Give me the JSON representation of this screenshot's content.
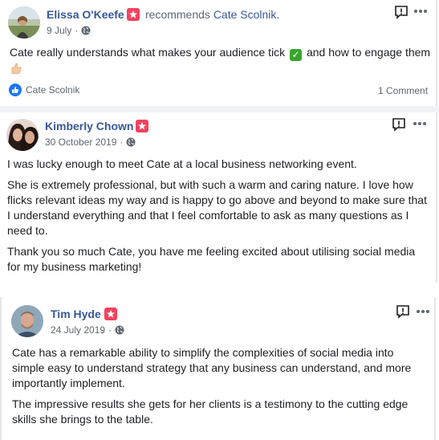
{
  "reviews": [
    {
      "author": "Elissa O'Keefe",
      "action": "recommends",
      "target": "Cate Scolnik.",
      "date": "9 July",
      "text_before_check": "Cate really understands what makes your audience tick ",
      "text_after_check": " and how to engage them",
      "reaction_name": "Cate Scolnik",
      "comments": "1 Comment"
    },
    {
      "author": "Kimberly Chown",
      "date": "30 October 2019",
      "paragraphs": [
        "I was lucky enough to meet Cate at a local business networking event.",
        "She is extremely professional, but with such a warm and caring nature. I love how flicks relevant ideas my way and is happy to go above and beyond to make sure that I understand everything and that I feel comfortable to ask as many questions as I need to.",
        "Thank you so much Cate, you have me feeling excited about utilising social media for my business marketing!"
      ]
    },
    {
      "author": "Tim Hyde",
      "date": "24 July 2019",
      "paragraphs": [
        "Cate has a remarkable ability to simplify the complexities of social media into simple easy to understand strategy that any business can understand, and more importantly implement.",
        "The impressive results she gets for her clients is a testimony to the cutting edge skills she brings to the table."
      ]
    }
  ],
  "meta_separator": "·",
  "icons": {
    "recommend_badge": "recommendation-star-icon",
    "privacy": "globe-icon",
    "report": "feedback-exclamation-icon",
    "more": "more-dots-icon",
    "like": "like-thumb-icon",
    "check_emoji": "check-mark-emoji",
    "thumb_emoji": "thumbs-up-emoji"
  },
  "colors": {
    "link": "#385898",
    "badge": "#f3425f",
    "like": "#1877f2",
    "secondary_text": "#606770"
  }
}
